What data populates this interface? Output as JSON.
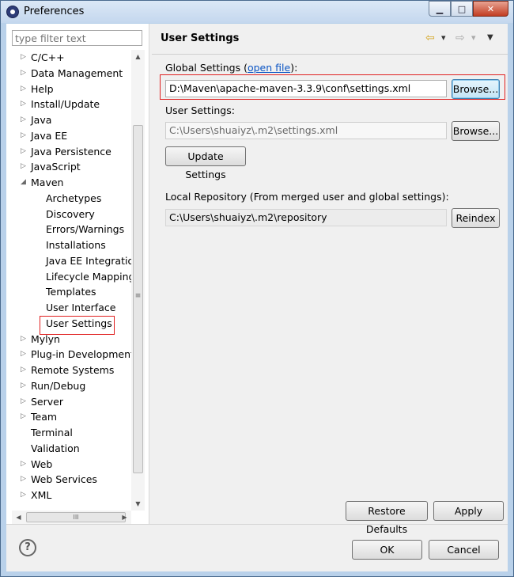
{
  "window": {
    "title": "Preferences",
    "controls": {
      "minimize": "▁",
      "maximize": "□",
      "close": "✕"
    }
  },
  "sidebar": {
    "filter_placeholder": "type filter text",
    "items": [
      {
        "label": "C/C++",
        "level": 0,
        "expander": "▷"
      },
      {
        "label": "Data Management",
        "level": 0,
        "expander": "▷"
      },
      {
        "label": "Help",
        "level": 0,
        "expander": "▷"
      },
      {
        "label": "Install/Update",
        "level": 0,
        "expander": "▷"
      },
      {
        "label": "Java",
        "level": 0,
        "expander": "▷"
      },
      {
        "label": "Java EE",
        "level": 0,
        "expander": "▷"
      },
      {
        "label": "Java Persistence",
        "level": 0,
        "expander": "▷"
      },
      {
        "label": "JavaScript",
        "level": 0,
        "expander": "▷"
      },
      {
        "label": "Maven",
        "level": 0,
        "expander": "◢"
      },
      {
        "label": "Archetypes",
        "level": 1,
        "expander": ""
      },
      {
        "label": "Discovery",
        "level": 1,
        "expander": ""
      },
      {
        "label": "Errors/Warnings",
        "level": 1,
        "expander": ""
      },
      {
        "label": "Installations",
        "level": 1,
        "expander": ""
      },
      {
        "label": "Java EE Integration",
        "level": 1,
        "expander": ""
      },
      {
        "label": "Lifecycle Mappings",
        "level": 1,
        "expander": ""
      },
      {
        "label": "Templates",
        "level": 1,
        "expander": ""
      },
      {
        "label": "User Interface",
        "level": 1,
        "expander": ""
      },
      {
        "label": "User Settings",
        "level": 1,
        "expander": "",
        "selected": true
      },
      {
        "label": "Mylyn",
        "level": 0,
        "expander": "▷"
      },
      {
        "label": "Plug-in Development",
        "level": 0,
        "expander": "▷"
      },
      {
        "label": "Remote Systems",
        "level": 0,
        "expander": "▷"
      },
      {
        "label": "Run/Debug",
        "level": 0,
        "expander": "▷"
      },
      {
        "label": "Server",
        "level": 0,
        "expander": "▷"
      },
      {
        "label": "Team",
        "level": 0,
        "expander": "▷"
      },
      {
        "label": "Terminal",
        "level": 0,
        "expander": ""
      },
      {
        "label": "Validation",
        "level": 0,
        "expander": ""
      },
      {
        "label": "Web",
        "level": 0,
        "expander": "▷"
      },
      {
        "label": "Web Services",
        "level": 0,
        "expander": "▷"
      },
      {
        "label": "XML",
        "level": 0,
        "expander": "▷"
      }
    ],
    "vscroll": {
      "up": "▲",
      "down": "▼",
      "grip": "≡"
    },
    "hscroll": {
      "left": "◀",
      "right": "▶",
      "grip": "III"
    }
  },
  "main": {
    "title": "User Settings",
    "nav": {
      "back": "⇦",
      "back_menu": "▾",
      "forward": "⇨",
      "forward_menu": "▾",
      "view_menu": "▼"
    },
    "global": {
      "label_prefix": "Global Settings (",
      "link": "open file",
      "label_suffix": "):",
      "value": "D:\\Maven\\apache-maven-3.3.9\\conf\\settings.xml",
      "browse": "Browse..."
    },
    "user": {
      "label": "User Settings:",
      "value": "C:\\Users\\shuaiyz\\.m2\\settings.xml",
      "browse": "Browse...",
      "update": "Update Settings"
    },
    "local": {
      "label": "Local Repository (From merged user and global settings):",
      "value": "C:\\Users\\shuaiyz\\.m2\\repository",
      "reindex": "Reindex"
    },
    "restore_defaults": "Restore Defaults",
    "apply": "Apply"
  },
  "footer": {
    "help": "?",
    "ok": "OK",
    "cancel": "Cancel"
  }
}
